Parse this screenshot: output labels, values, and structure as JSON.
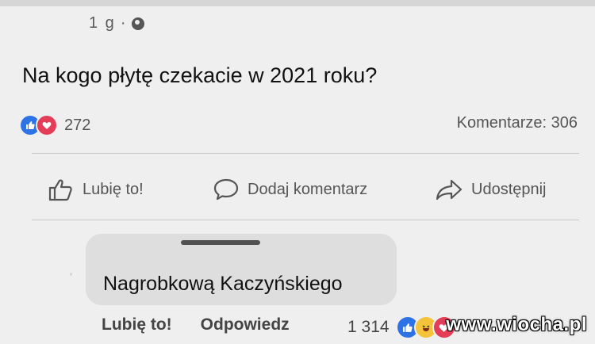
{
  "post": {
    "meta_time": "1 g",
    "meta_sep": "·",
    "text": "Na kogo płytę czekacie w 2021 roku?",
    "reaction_count": "272",
    "comments_label": "Komentarze: 306"
  },
  "actions": {
    "like": "Lubię to!",
    "comment": "Dodaj komentarz",
    "share": "Udostępnij"
  },
  "reply": {
    "text": "Nagrobkową Kaczyńskiego",
    "like": "Lubię to!",
    "respond": "Odpowiedz",
    "reaction_count": "1 314"
  },
  "watermark": "www.wiocha.pl",
  "icons": {
    "privacy": "globe-icon",
    "like": "thumbs-up-icon",
    "comment": "speech-bubble-icon",
    "share": "share-arrow-icon"
  },
  "colors": {
    "like_blue": "#2e73e6",
    "love_red": "#e43d57",
    "haha_yellow": "#f5c33b"
  }
}
